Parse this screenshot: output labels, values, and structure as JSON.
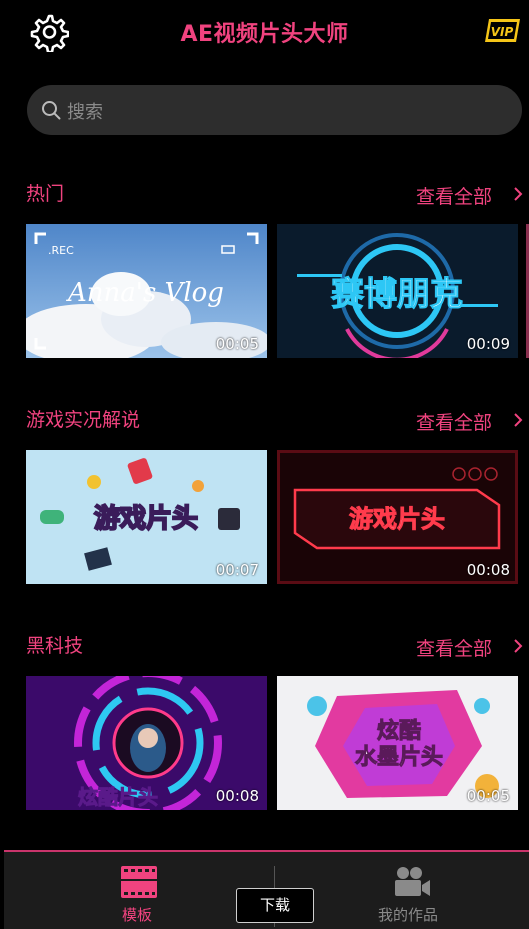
{
  "header": {
    "title": "AE视频片头大师",
    "vip_badge": "VIP"
  },
  "search": {
    "placeholder": "搜索"
  },
  "sections": [
    {
      "title": "热门",
      "see_all": "查看全部",
      "items": [
        {
          "overlay_text": "Anna's Vlog",
          "rec_label": ".REC",
          "duration": "00:05"
        },
        {
          "overlay_text": "赛博朋克",
          "duration": "00:09"
        }
      ]
    },
    {
      "title": "游戏实况解说",
      "see_all": "查看全部",
      "items": [
        {
          "overlay_text": "游戏片头",
          "duration": "00:07"
        },
        {
          "overlay_text": "游戏片头",
          "duration": "00:08"
        }
      ]
    },
    {
      "title": "黑科技",
      "see_all": "查看全部",
      "items": [
        {
          "overlay_text": "炫酷片头",
          "duration": "00:08"
        },
        {
          "overlay_text_1": "炫酷",
          "overlay_text_2": "水墨片头",
          "duration": "00:05"
        }
      ]
    }
  ],
  "tabbar": {
    "tabs": [
      {
        "label": "模板",
        "icon": "templates-icon",
        "active": true
      },
      {
        "label": "我的作品",
        "icon": "video-camera-icon",
        "active": false
      }
    ],
    "download_label": "下载"
  },
  "colors": {
    "accent": "#f0437f",
    "background": "#000000",
    "search_bg": "#2d2d2d",
    "vip": "#f5c518"
  }
}
